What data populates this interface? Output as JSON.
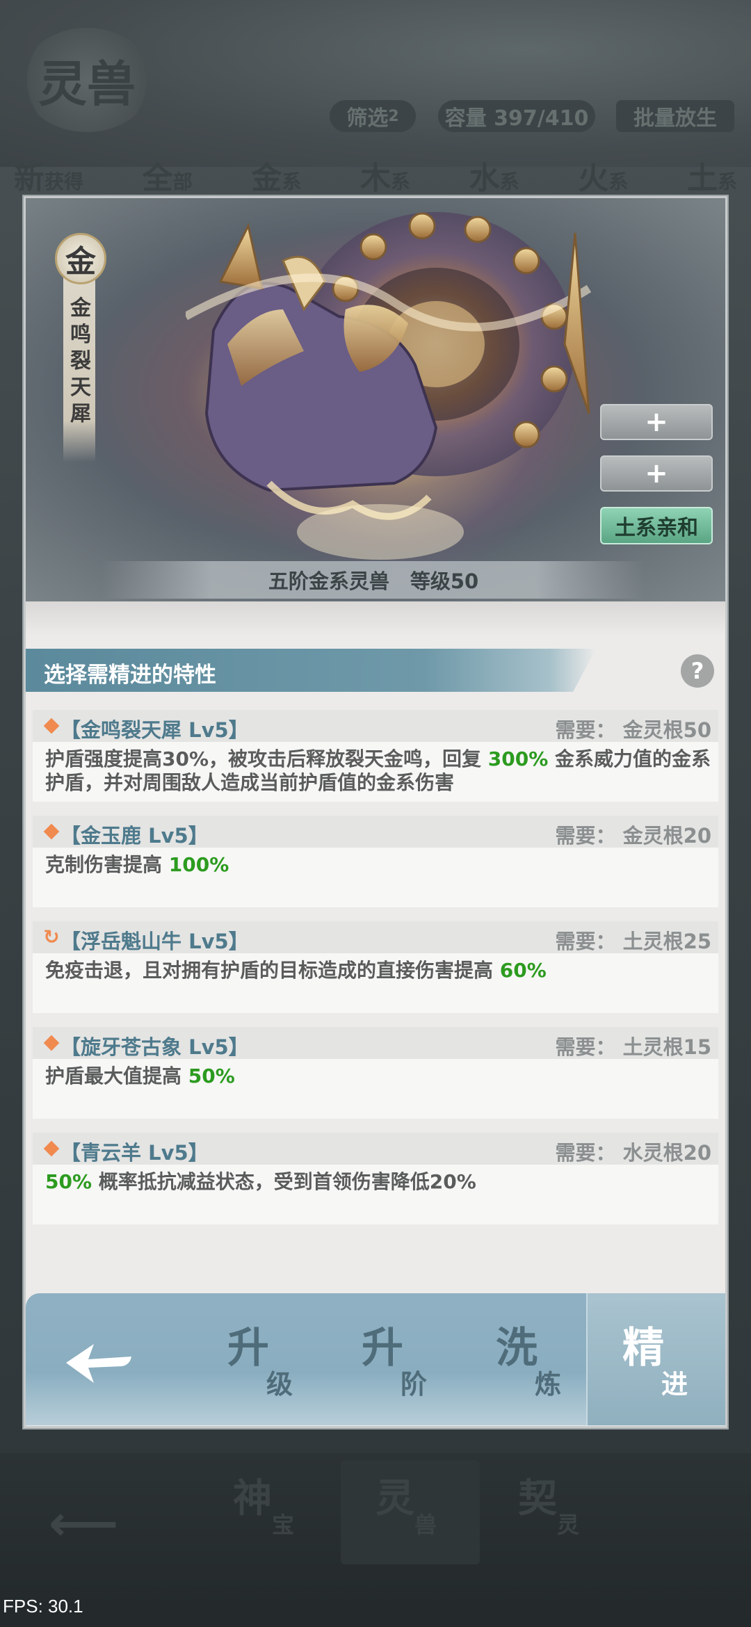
{
  "background": {
    "title_glyph": "灵兽",
    "filter_label": "筛选",
    "filter_count": "2",
    "capacity_label": "容量 397/410",
    "batch_release_label": "批量放生",
    "tabs": [
      {
        "big": "新",
        "small": "获得"
      },
      {
        "big": "全",
        "small": "部"
      },
      {
        "big": "金",
        "small": "系"
      },
      {
        "big": "木",
        "small": "系"
      },
      {
        "big": "水",
        "small": "系"
      },
      {
        "big": "火",
        "small": "系"
      },
      {
        "big": "土",
        "small": "系"
      }
    ],
    "bottom_nav": [
      {
        "big": "神",
        "small": "宝"
      },
      {
        "big": "灵",
        "small": "兽"
      },
      {
        "big": "契",
        "small": "灵"
      }
    ]
  },
  "hero": {
    "element_glyph": "金",
    "beast_name": "金鸣裂天犀",
    "slot1": "+",
    "slot2": "+",
    "affinity_label": "土系亲和",
    "caption_tier": "五阶金系灵兽",
    "caption_level": "等级50"
  },
  "section": {
    "title": "选择需精进的特性",
    "help": "?"
  },
  "traits": [
    {
      "icon": "diamond",
      "name": "【金鸣裂天犀 Lv5】",
      "requirement": "需要：  金灵根50",
      "desc_pre": "护盾强度提高30%，被攻击后释放裂天金鸣，回复 ",
      "desc_hl": "300%",
      "desc_post": " 金系威力值的金系护盾，并对周围敌人造成当前护盾值的金系伤害"
    },
    {
      "icon": "diamond",
      "name": "【金玉鹿 Lv5】",
      "requirement": "需要：  金灵根20",
      "desc_pre": "克制伤害提高 ",
      "desc_hl": "100%",
      "desc_post": ""
    },
    {
      "icon": "refresh",
      "name": "【浮岳魁山牛 Lv5】",
      "requirement": "需要：  土灵根25",
      "desc_pre": "免疫击退，且对拥有护盾的目标造成的直接伤害提高 ",
      "desc_hl": "60%",
      "desc_post": ""
    },
    {
      "icon": "diamond",
      "name": "【旋牙苍古象 Lv5】",
      "requirement": "需要：  土灵根15",
      "desc_pre": "护盾最大值提高 ",
      "desc_hl": "50%",
      "desc_post": ""
    },
    {
      "icon": "diamond",
      "name": "【青云羊 Lv5】",
      "requirement": "需要：  水灵根20",
      "desc_pre": "",
      "desc_hl": "50%",
      "desc_post": " 概率抵抗减益状态，受到首领伤害降低20%"
    }
  ],
  "actions": [
    {
      "big": "升",
      "small": "级"
    },
    {
      "big": "升",
      "small": "阶"
    },
    {
      "big": "洗",
      "small": "炼"
    },
    {
      "big": "精",
      "small": "进"
    }
  ],
  "fps": "FPS: 30.1",
  "colors": {
    "highlight": "#2c9b1f",
    "trait_name": "#4e7a8c",
    "icon_orange": "#f08a4f",
    "affinity_green": "#5aa584"
  }
}
